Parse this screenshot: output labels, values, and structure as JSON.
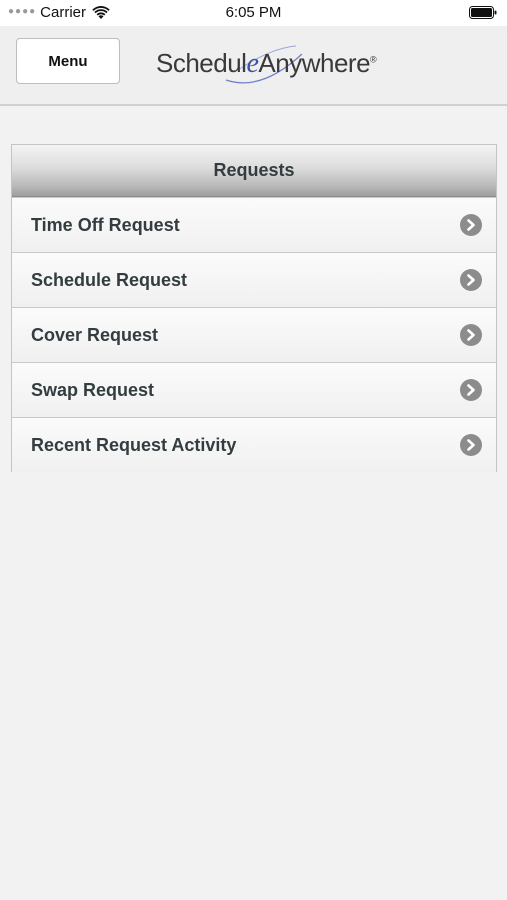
{
  "status_bar": {
    "carrier": "Carrier",
    "time": "6:05 PM",
    "icons": [
      "signal-dots-icon",
      "wifi-icon",
      "battery-icon"
    ]
  },
  "header": {
    "menu_label": "Menu",
    "logo": {
      "part1": "Schedul",
      "part2": "e",
      "part3": "Anywhere",
      "registered": "®"
    }
  },
  "requests": {
    "title": "Requests",
    "items": [
      {
        "label": "Time Off Request",
        "icon": "chevron-right-icon"
      },
      {
        "label": "Schedule Request",
        "icon": "chevron-right-icon"
      },
      {
        "label": "Cover Request",
        "icon": "chevron-right-icon"
      },
      {
        "label": "Swap Request",
        "icon": "chevron-right-icon"
      },
      {
        "label": "Recent Request Activity",
        "icon": "chevron-right-icon"
      }
    ]
  },
  "colors": {
    "background": "#f2f2f2",
    "text": "#333d40",
    "logo_accent": "#3f4fa6",
    "arrow": "#8c8c8c"
  }
}
